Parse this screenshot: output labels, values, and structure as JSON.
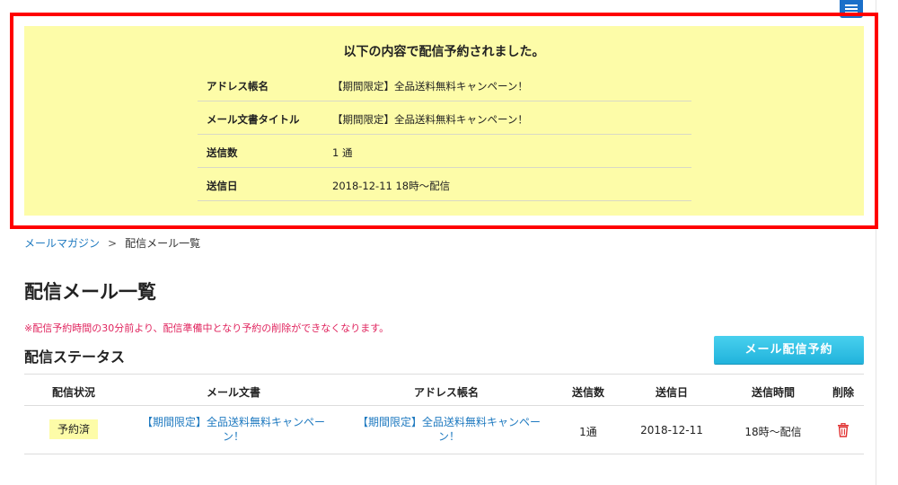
{
  "notice": {
    "title": "以下の内容で配信予約されました。",
    "rows": [
      {
        "label": "アドレス帳名",
        "value": "【期間限定】全品送料無料キャンペーン！"
      },
      {
        "label": "メール文書タイトル",
        "value": "【期間限定】全品送料無料キャンペーン！"
      },
      {
        "label": "送信数",
        "value": "1 通"
      },
      {
        "label": "送信日",
        "value": "2018-12-11 18時〜配信"
      }
    ]
  },
  "breadcrumb": {
    "root": "メールマガジン",
    "separator": ">",
    "current": "配信メール一覧"
  },
  "page_title": "配信メール一覧",
  "warning": "※配信予約時間の30分前より、配信準備中となり予約の削除ができなくなります。",
  "section_title": "配信ステータス",
  "reserve_button": "メール配信予約",
  "table": {
    "headers": [
      "配信状況",
      "メール文書",
      "アドレス帳名",
      "送信数",
      "送信日",
      "送信時間",
      "削除"
    ],
    "rows": [
      {
        "status": "予約済",
        "mail_line1": "【期間限定】全品送料無料キャンペー",
        "mail_line2": "ン！",
        "address_line1": "【期間限定】全品送料無料キャンペー",
        "address_line2": "ン！",
        "count": "1通",
        "date": "2018-12-11",
        "time": "18時〜配信"
      }
    ]
  },
  "icons": {
    "menu": "hamburger-menu-icon",
    "delete": "trash-icon"
  },
  "colors": {
    "accent_link": "#1f7ac0",
    "notice_bg": "#fdfca8",
    "warning": "#e0245e",
    "delete_icon": "#e03030",
    "button": "#21b3dc",
    "highlight_frame": "#ff0000"
  }
}
